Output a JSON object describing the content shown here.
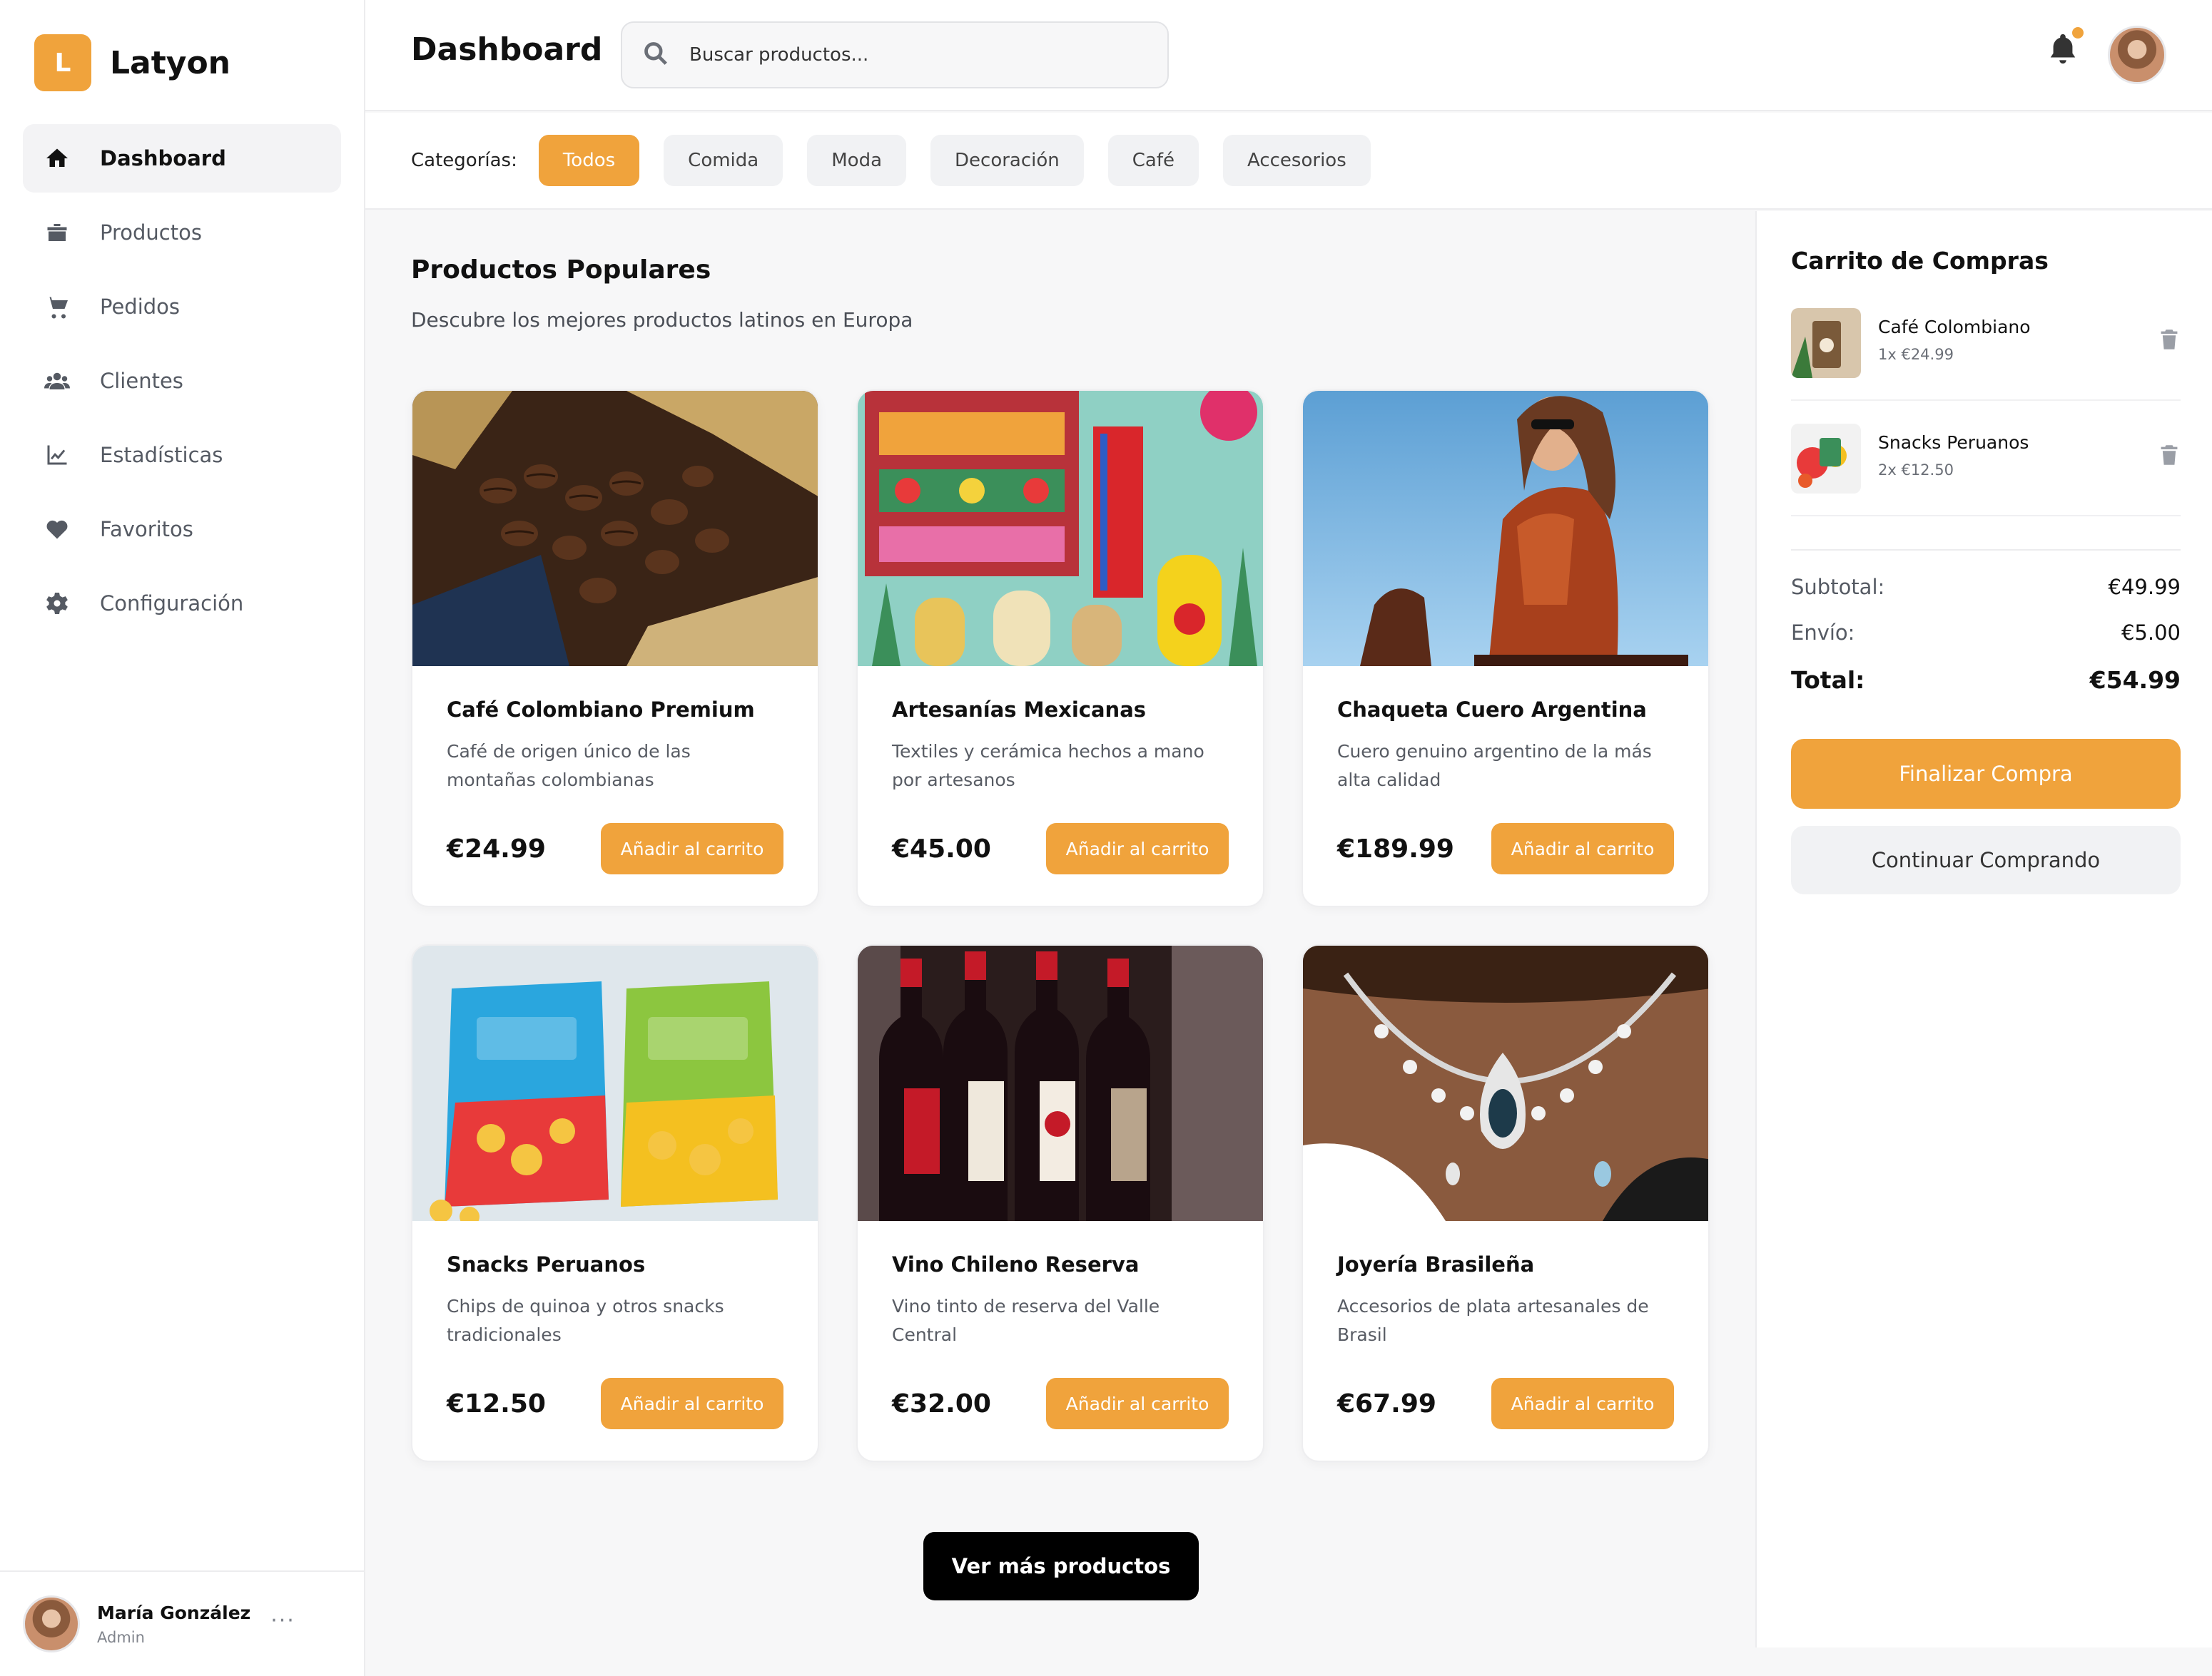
{
  "brand": {
    "initial": "L",
    "name": "Latyon"
  },
  "nav": [
    {
      "label": "Dashboard",
      "icon": "home-icon",
      "active": true
    },
    {
      "label": "Productos",
      "icon": "box-icon"
    },
    {
      "label": "Pedidos",
      "icon": "cart-icon"
    },
    {
      "label": "Clientes",
      "icon": "users-icon"
    },
    {
      "label": "Estadísticas",
      "icon": "chart-line-icon"
    },
    {
      "label": "Favoritos",
      "icon": "heart-icon"
    },
    {
      "label": "Configuración",
      "icon": "gear-icon"
    }
  ],
  "user": {
    "name": "María González",
    "role": "Admin",
    "more": "···"
  },
  "header": {
    "title": "Dashboard",
    "search_placeholder": "Buscar productos..."
  },
  "categories": {
    "label": "Categorías:",
    "items": [
      "Todos",
      "Comida",
      "Moda",
      "Decoración",
      "Café",
      "Accesorios"
    ],
    "selected": "Todos"
  },
  "main": {
    "title": "Productos Populares",
    "subtitle": "Descubre los mejores productos latinos en Europa",
    "more_button": "Ver más productos"
  },
  "products": [
    {
      "name": "Café Colombiano Premium",
      "desc": "Café de origen único de las montañas colombianas",
      "price": "€24.99",
      "button": "Añadir al carrito"
    },
    {
      "name": "Artesanías Mexicanas",
      "desc": "Textiles y cerámica hechos a mano por artesanos",
      "price": "€45.00",
      "button": "Añadir al carrito"
    },
    {
      "name": "Chaqueta Cuero Argentina",
      "desc": "Cuero genuino argentino de la más alta calidad",
      "price": "€189.99",
      "button": "Añadir al carrito"
    },
    {
      "name": "Snacks Peruanos",
      "desc": "Chips de quinoa y otros snacks tradicionales",
      "price": "€12.50",
      "button": "Añadir al carrito"
    },
    {
      "name": "Vino Chileno Reserva",
      "desc": "Vino tinto de reserva del Valle Central",
      "price": "€32.00",
      "button": "Añadir al carrito"
    },
    {
      "name": "Joyería Brasileña",
      "desc": "Accesorios de plata artesanales de Brasil",
      "price": "€67.99",
      "button": "Añadir al carrito"
    }
  ],
  "cart": {
    "title": "Carrito de Compras",
    "items": [
      {
        "name": "Café Colombiano",
        "qty": "1x €24.99"
      },
      {
        "name": "Snacks Peruanos",
        "qty": "2x €12.50"
      }
    ],
    "subtotal_label": "Subtotal:",
    "subtotal": "€49.99",
    "shipping_label": "Envío:",
    "shipping": "€5.00",
    "total_label": "Total:",
    "total": "€54.99",
    "checkout": "Finalizar Compra",
    "continue": "Continuar Comprando"
  },
  "colors": {
    "accent": "#f0a33c",
    "dark_button": "#000000"
  }
}
